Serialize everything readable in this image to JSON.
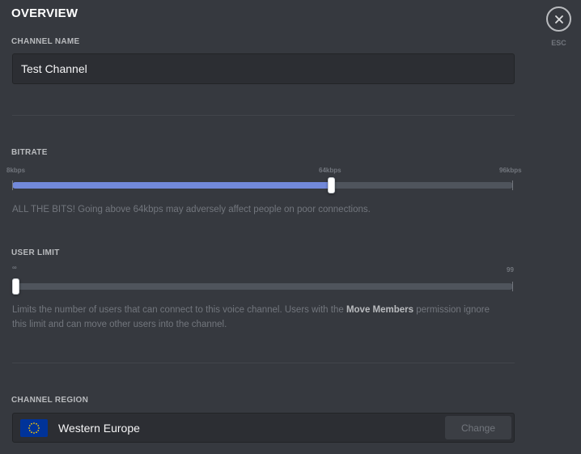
{
  "header": {
    "title": "OVERVIEW"
  },
  "close": {
    "icon": "close-icon",
    "esc_label": "ESC"
  },
  "channel_name": {
    "label": "CHANNEL NAME",
    "value": "Test Channel"
  },
  "bitrate": {
    "label": "BITRATE",
    "min_label": "8kbps",
    "mid_label": "64kbps",
    "max_label": "96kbps",
    "min": 8,
    "max": 96,
    "value": 64,
    "accent_color": "#7289da",
    "note": "ALL THE BITS! Going above 64kbps may adversely affect people on poor connections."
  },
  "user_limit": {
    "label": "USER LIMIT",
    "min_label": "∞",
    "max_label": "99",
    "min": 0,
    "max": 99,
    "value": 0,
    "note_before": "Limits the number of users that can connect to this voice channel. Users with the ",
    "note_bold": "Move Members",
    "note_after": " permission ignore this limit and can move other users into the channel."
  },
  "region": {
    "label": "CHANNEL REGION",
    "flag_icon": "eu-flag-icon",
    "name": "Western Europe",
    "change_label": "Change"
  }
}
